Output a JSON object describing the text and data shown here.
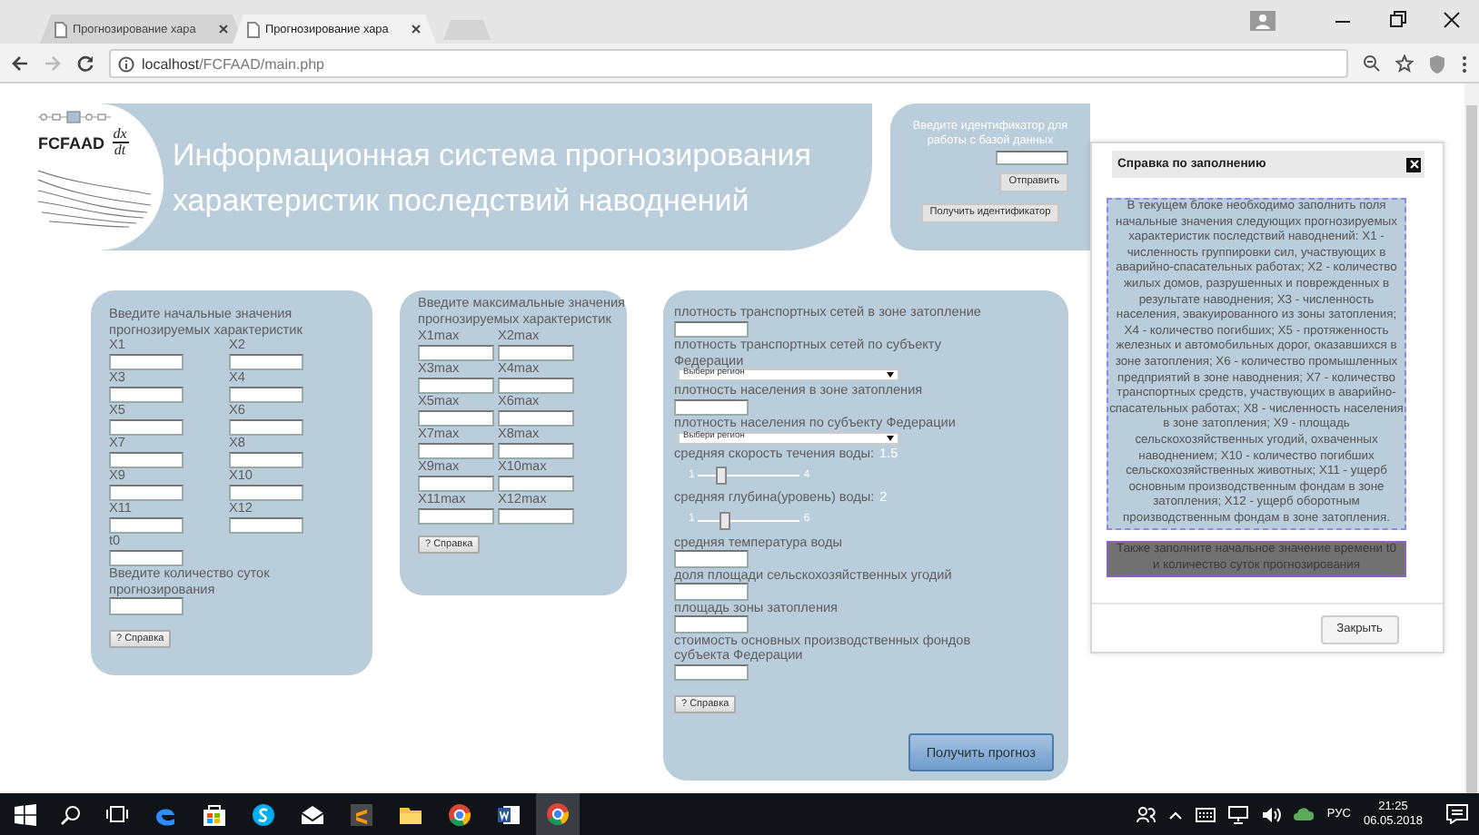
{
  "browser": {
    "tabs": [
      {
        "title": "Прогнозирование хара",
        "selected": false
      },
      {
        "title": "Прогнозирование хара",
        "selected": true
      }
    ],
    "url_host": "localhost",
    "url_path": "/FCFAAD/main.php"
  },
  "header": {
    "logo": "FCFAAD",
    "formula_top": "dx",
    "formula_bottom": "dt",
    "title_lines": [
      "Информационная система прогнозирования",
      "характеристик последствий наводнений"
    ]
  },
  "login": {
    "prompt": "Введите идентификатор для работы с базой данных",
    "submit": "Отправить",
    "get_id": "Получить идентификатор"
  },
  "initial_panel": {
    "title": "Введите начальные значения прогнозируемых характеристик",
    "fields": [
      "X1",
      "X2",
      "X3",
      "X4",
      "X5",
      "X6",
      "X7",
      "X8",
      "X9",
      "X10",
      "X11",
      "X12"
    ],
    "t0_label": "t0",
    "days_label": "Введите количество суток прогнозирования",
    "help_button": "? Справка"
  },
  "max_panel": {
    "title": "Введите максимальные значения прогнозируемых характеристик",
    "fields": [
      "X1max",
      "X2max",
      "X3max",
      "X4max",
      "X5max",
      "X6max",
      "X7max",
      "X8max",
      "X9max",
      "X10max",
      "X11max",
      "X12max"
    ],
    "help_button": "? Справка"
  },
  "params_panel": {
    "items": [
      {
        "kind": "input",
        "label": "плотность транспортных сетей в зоне затопление"
      },
      {
        "kind": "select",
        "label": "плотность транспортных сетей по субъекту Федерации",
        "value": "Выбери регион"
      },
      {
        "kind": "input",
        "label": "плотность населения в зоне затопления"
      },
      {
        "kind": "select",
        "label": "плотность населения по субъекту Федерации",
        "value": "Выбери регион"
      },
      {
        "kind": "slider",
        "label": "средняя скорость течения воды:",
        "value": "1.5",
        "min": "1",
        "max": "4",
        "level": 0.17
      },
      {
        "kind": "slider",
        "label": "средняя глубина(уровень) воды:",
        "value": "2",
        "min": "1",
        "max": "6",
        "level": 0.2
      },
      {
        "kind": "input",
        "label": "средняя температура воды"
      },
      {
        "kind": "input",
        "label": "доля площади сельскохозяйственных угодий"
      },
      {
        "kind": "input",
        "label": "площадь зоны затопления"
      },
      {
        "kind": "input",
        "label": "стоимость основных производственных фондов субъекта Федерации"
      }
    ],
    "help_button": "? Справка",
    "submit": "Получить прогноз"
  },
  "help_dialog": {
    "title": "Справка по заполнению",
    "text": "В текущем блоке необходимо заполнить поля начальные значения следующих прогнозируемых характеристик последствий наводнений: X1 - численность группировки сил, участвующих в аварийно-спасательных работах; X2 - количество жилых домов, разрушенных и поврежденных в результате наводнения; X3 - численность населения, эвакуированного из зоны затопления; X4 - количество погибших; X5 - протяженность железных и автомобильных дорог, оказавшихся в зоне затопления; X6 - количество промышленных предприятий в зоне наводнения; X7 - количество транспортных средств, участвующих в аварийно-спасательных работах; X8 - численность населения в зоне затопления; X9 - площадь сельскохозяйственных угодий, охваченных наводнением; X10 - количество погибших сельскохозяйственных животных; X11 - ущерб основным производственным фондам в зоне затопления; X12 - ущерб оборотным производственным фондам в зоне затопления.",
    "note": "Также заполните начальное значение времени t0 и количество суток прогнозирования",
    "close": "Закрыть"
  },
  "taskbar": {
    "language": "РУС",
    "time": "21:25",
    "date": "06.05.2018"
  }
}
